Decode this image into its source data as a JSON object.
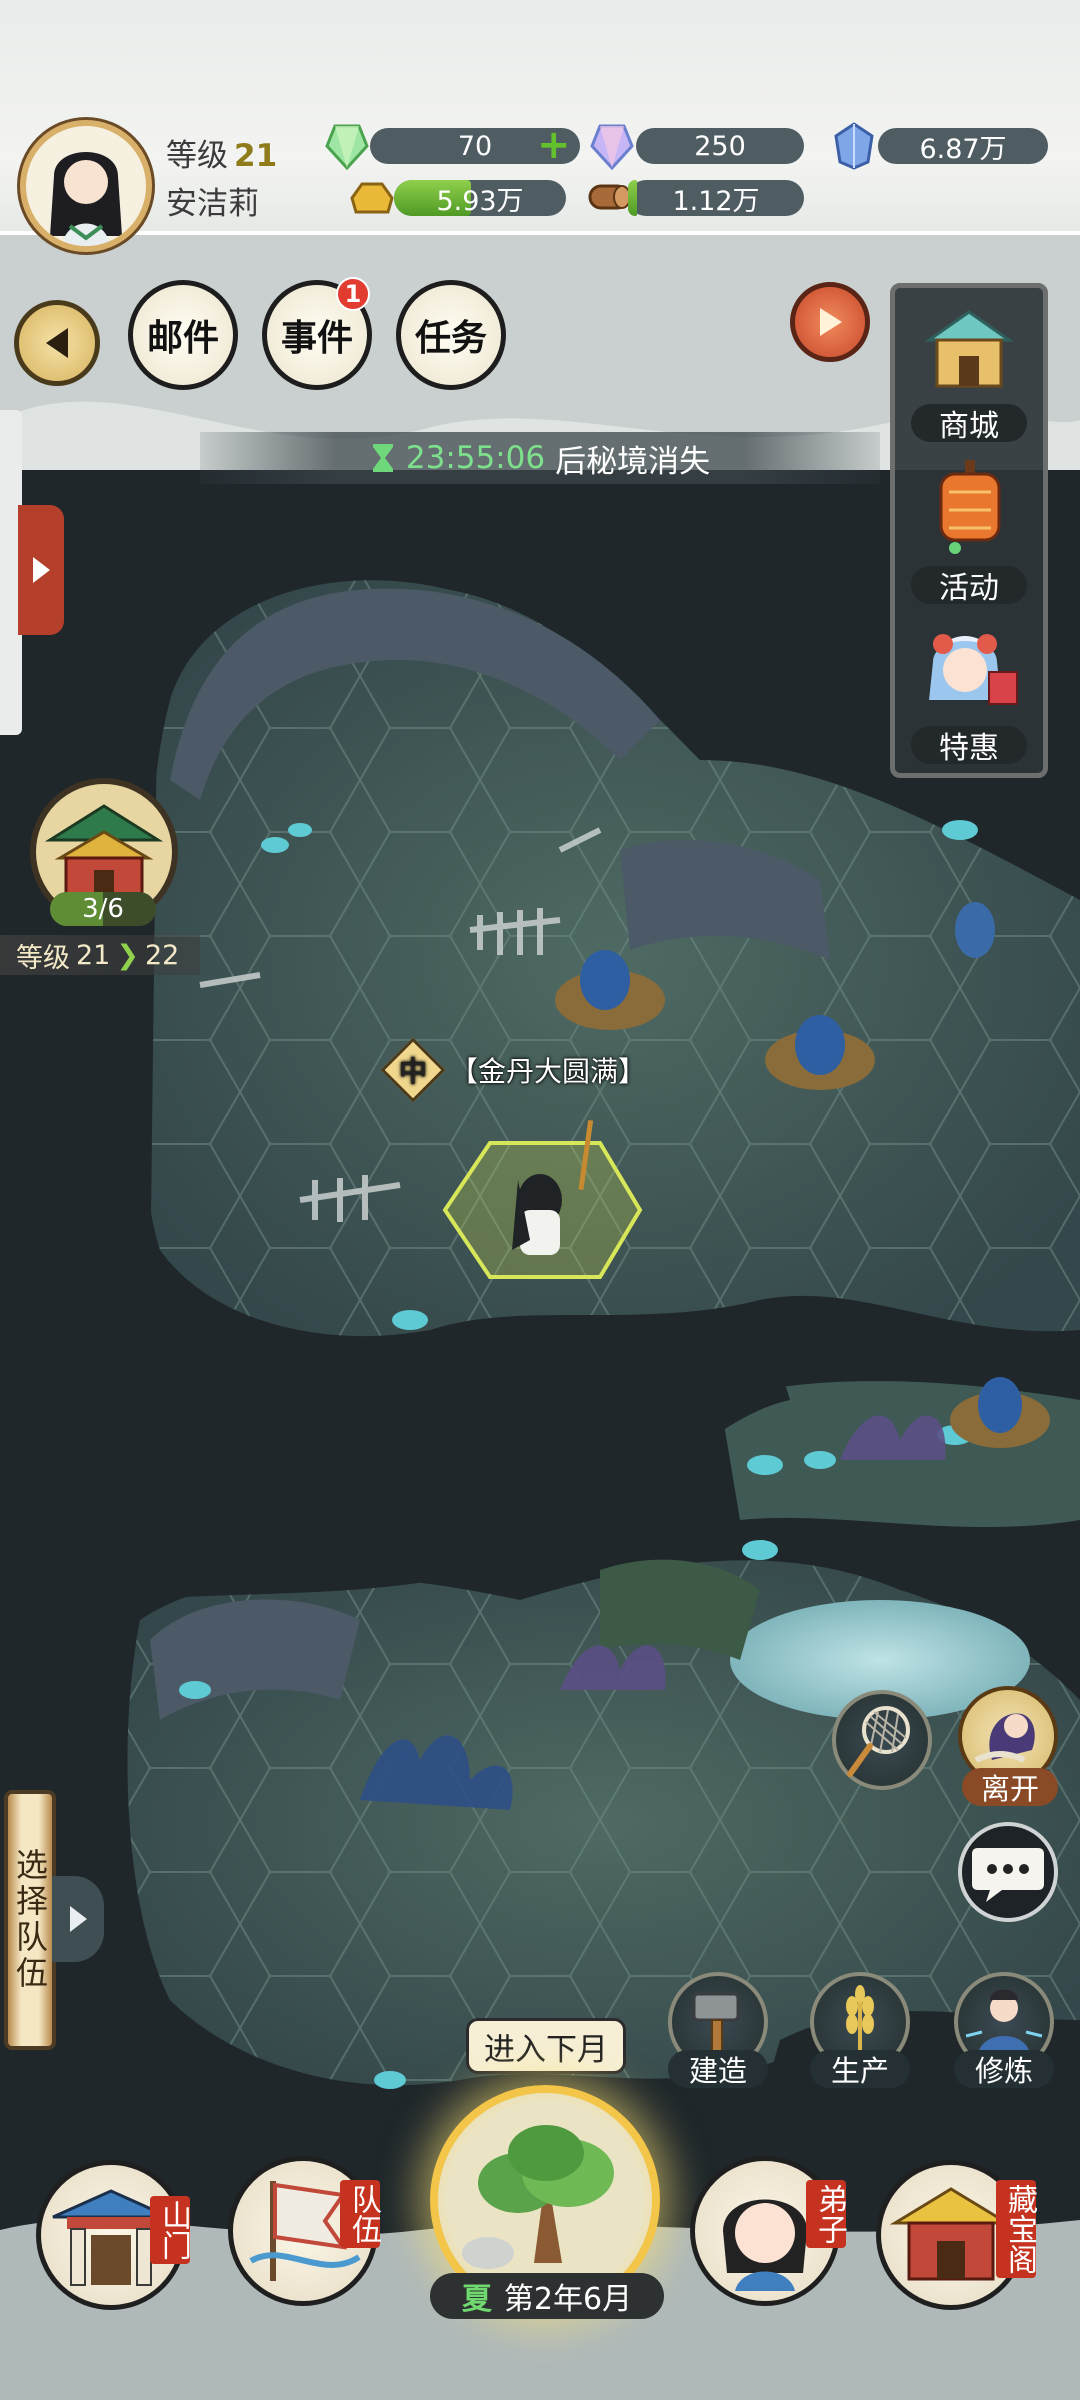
{
  "player": {
    "level_label": "等级",
    "level": "21",
    "name": "安洁莉"
  },
  "resources": {
    "spirit_stone_green": "70",
    "spirit_stone_rainbow": "250",
    "crystal": "6.87万",
    "gold": "5.93万",
    "wood": "1.12万"
  },
  "resource_fill": {
    "gold": 0.45,
    "wood": 0.05
  },
  "toolbar": {
    "mail_label": "邮件",
    "events_label": "事件",
    "events_badge": "1",
    "tasks_label": "任务"
  },
  "timer": {
    "time": "23:55:06",
    "text": "后秘境消失"
  },
  "side_menu": {
    "shop": "商城",
    "activity": "活动",
    "special": "特惠"
  },
  "sect": {
    "count": "3/6",
    "count_fill": 0.5,
    "level_label": "等级",
    "level_from": "21",
    "level_to": "22"
  },
  "hero": {
    "tag": "中",
    "realm": "【金丹大圆满】"
  },
  "team": {
    "select_label": "选择队伍"
  },
  "actions": {
    "leave": "离开",
    "build": "建造",
    "produce": "生产",
    "cultivate": "修炼"
  },
  "bottom_nav": {
    "gate": "山门",
    "team": "队伍",
    "disciples": "弟子",
    "treasury": "藏宝阁",
    "next_month": "进入下月",
    "season": "夏",
    "date": "第2年6月"
  },
  "colors": {
    "fog_dark": "#1f272b",
    "hex_floor": "#3f5a54",
    "highlight_hex": "#c9d94a",
    "accent_green": "#8fd04c",
    "badge_red": "#e23b2f"
  }
}
